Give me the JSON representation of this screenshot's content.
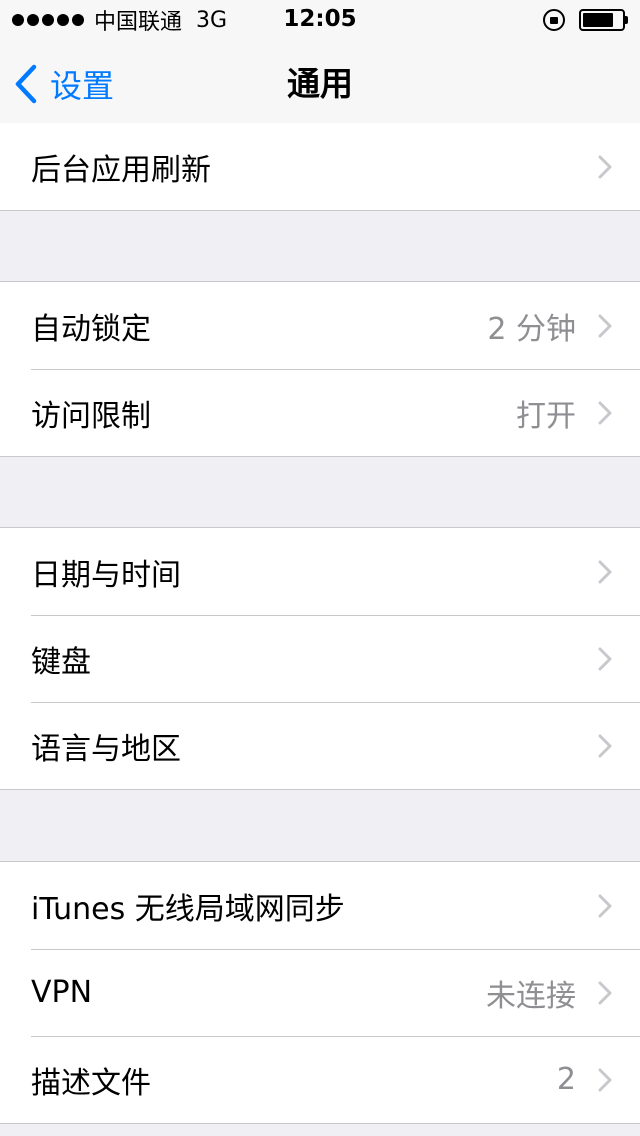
{
  "status_bar": {
    "carrier": "中国联通",
    "network": "3G",
    "time": "12:05",
    "battery_level": 0.8
  },
  "nav": {
    "back_label": "设置",
    "title": "通用"
  },
  "sections": [
    {
      "rows": [
        {
          "label": "后台应用刷新",
          "value": ""
        }
      ]
    },
    {
      "rows": [
        {
          "label": "自动锁定",
          "value": "2 分钟"
        },
        {
          "label": "访问限制",
          "value": "打开"
        }
      ]
    },
    {
      "rows": [
        {
          "label": "日期与时间",
          "value": ""
        },
        {
          "label": "键盘",
          "value": ""
        },
        {
          "label": "语言与地区",
          "value": ""
        }
      ]
    },
    {
      "rows": [
        {
          "label": "iTunes 无线局域网同步",
          "value": ""
        },
        {
          "label": "VPN",
          "value": "未连接"
        },
        {
          "label": "描述文件",
          "value": "2"
        }
      ]
    }
  ],
  "colors": {
    "accent": "#007aff",
    "background": "#efeff4",
    "secondary_text": "#8e8e93",
    "separator": "#c8c7cc"
  }
}
